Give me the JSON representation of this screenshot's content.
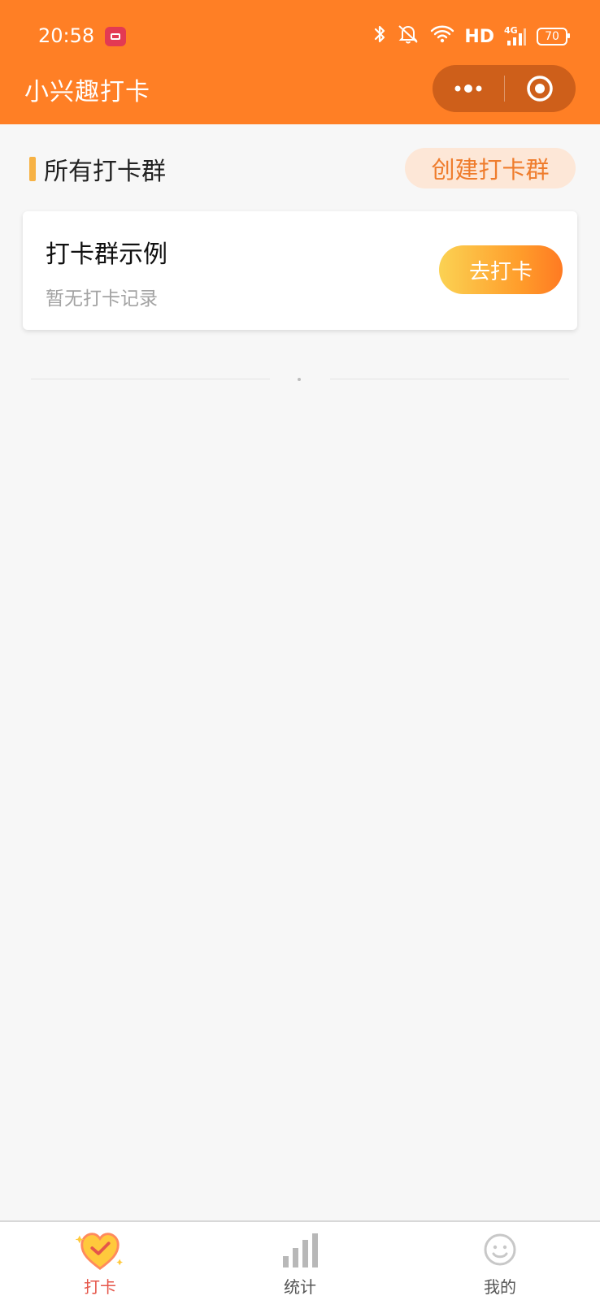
{
  "status_bar": {
    "time": "20:58",
    "network_label": "HD",
    "network_gen": "4G",
    "battery": "70"
  },
  "nav": {
    "title": "小兴趣打卡"
  },
  "section": {
    "title": "所有打卡群",
    "create_button": "创建打卡群"
  },
  "groups": [
    {
      "name": "打卡群示例",
      "subtitle": "暂无打卡记录",
      "action": "去打卡"
    }
  ],
  "tabs": [
    {
      "label": "打卡",
      "icon": "heart-check-icon",
      "active": true
    },
    {
      "label": "统计",
      "icon": "bar-chart-icon",
      "active": false
    },
    {
      "label": "我的",
      "icon": "user-face-icon",
      "active": false
    }
  ],
  "colors": {
    "brand_orange": "#ff7f25",
    "capsule": "#ce5f1a",
    "create_bg": "#fde7d7",
    "create_text": "#ef7c2c",
    "active_tab": "#e5564a"
  }
}
